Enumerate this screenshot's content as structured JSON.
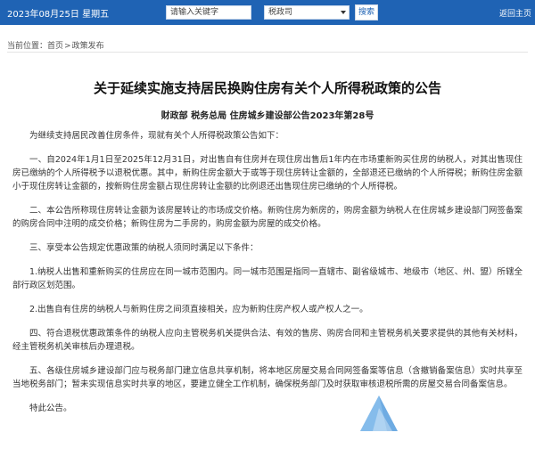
{
  "topbar": {
    "date": "2023年08月25日  星期五",
    "search_placeholder": "请输入关键字",
    "select_value": "税政司",
    "search_button": "搜索",
    "home_link": "返回主页"
  },
  "breadcrumb": {
    "prefix": "当前位置：",
    "home": "首页",
    "separator": ">",
    "section": "政策发布"
  },
  "article": {
    "title": "关于延续实施支持居民换购住房有关个人所得税政策的公告",
    "subtitle": "财政部 税务总局 住房城乡建设部公告2023年第28号",
    "paragraphs": [
      "为继续支持居民改善住房条件，现就有关个人所得税政策公告如下：",
      "一、自2024年1月1日至2025年12月31日，对出售自有住房并在现住房出售后1年内在市场重新购买住房的纳税人，对其出售现住房已缴纳的个人所得税予以退税优惠。其中，新购住房金额大于或等于现住房转让金额的，全部退还已缴纳的个人所得税；新购住房金额小于现住房转让金额的，按新购住房金额占现住房转让金额的比例退还出售现住房已缴纳的个人所得税。",
      "二、本公告所称现住房转让金额为该房屋转让的市场成交价格。新购住房为新房的，购房金额为纳税人在住房城乡建设部门网签备案的购房合同中注明的成交价格；新购住房为二手房的，购房金额为房屋的成交价格。",
      "三、享受本公告规定优惠政策的纳税人须同时满足以下条件：",
      "1.纳税人出售和重新购买的住房应在同一城市范围内。同一城市范围是指同一直辖市、副省级城市、地级市（地区、州、盟）所辖全部行政区划范围。",
      "2.出售自有住房的纳税人与新购住房之间须直接相关，应为新购住房产权人或产权人之一。",
      "四、符合退税优惠政策条件的纳税人应向主管税务机关提供合法、有效的售房、购房合同和主管税务机关要求提供的其他有关材料，经主管税务机关审核后办理退税。",
      "五、各级住房城乡建设部门应与税务部门建立信息共享机制，将本地区房屋交易合同网签备案等信息（含撤销备案信息）实时共享至当地税务部门；暂未实现信息实时共享的地区，要建立健全工作机制，确保税务部门及时获取审核退税所需的房屋交易合同备案信息。",
      "特此公告。"
    ]
  },
  "colors": {
    "header_bg": "#1f63b4",
    "title_color": "#111111"
  },
  "icons": {
    "watermark": "triangle-logo-icon"
  }
}
